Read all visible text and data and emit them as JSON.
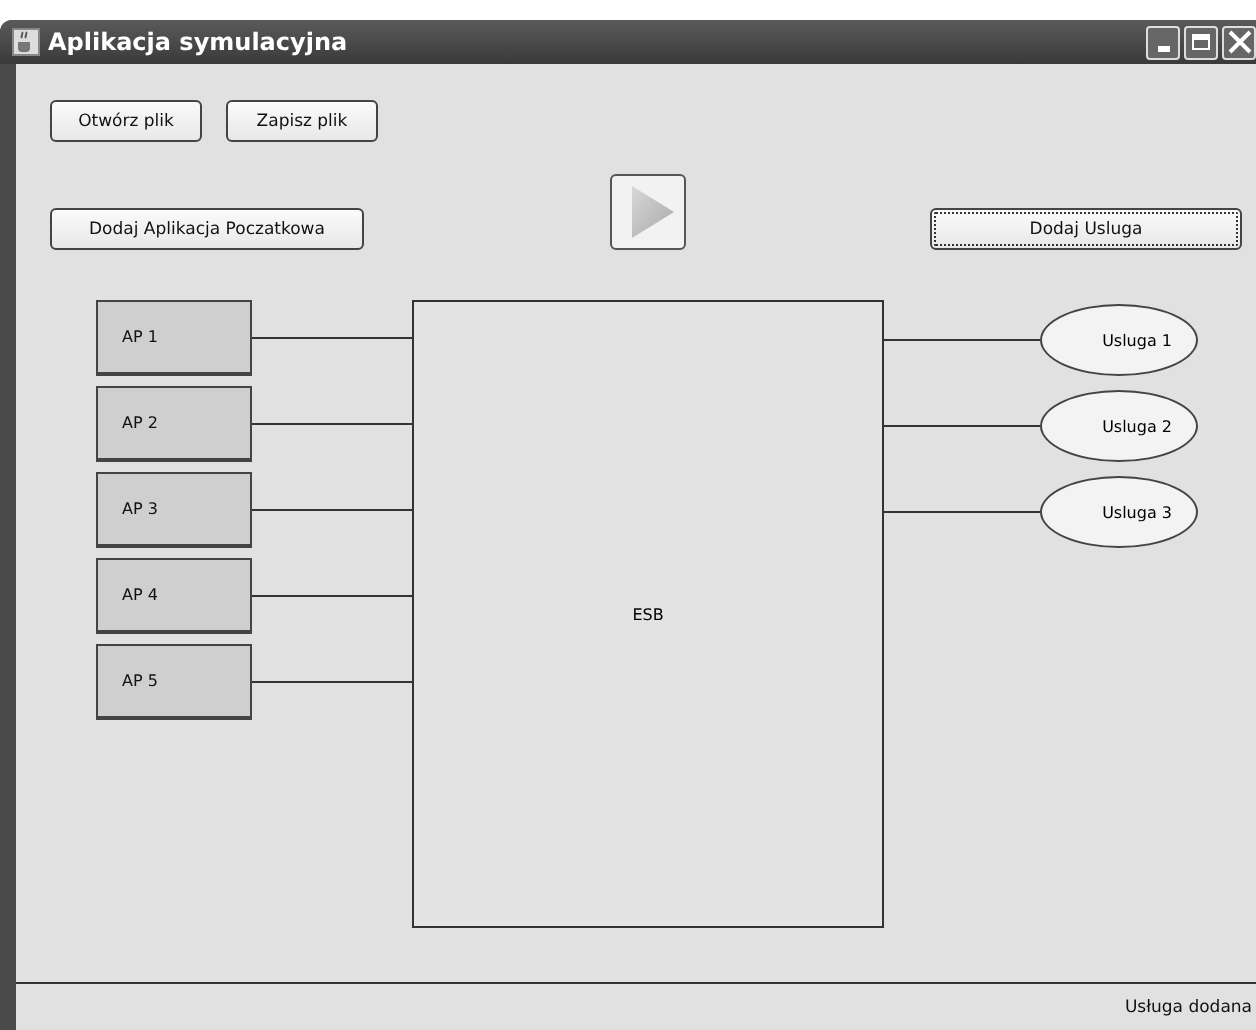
{
  "window": {
    "title": "Aplikacja symulacyjna"
  },
  "file_buttons": [
    {
      "label": "Otwórz plik",
      "focused": false
    },
    {
      "label": "Zapisz plik",
      "focused": false
    }
  ],
  "add_app_button": {
    "label": "Dodaj Aplikacja Poczatkowa",
    "focused": false
  },
  "add_service_button": {
    "label": "Dodaj Usluga",
    "focused": true
  },
  "applications": [
    {
      "label": "AP 1"
    },
    {
      "label": "AP 2"
    },
    {
      "label": "AP 3"
    },
    {
      "label": "AP 4"
    },
    {
      "label": "AP 5"
    }
  ],
  "esb": {
    "label": "ESB"
  },
  "services": [
    {
      "label": "Usluga 1"
    },
    {
      "label": "Usluga 2"
    },
    {
      "label": "Usluga 3"
    }
  ],
  "status_bar": {
    "text": "Usługa dodana"
  }
}
